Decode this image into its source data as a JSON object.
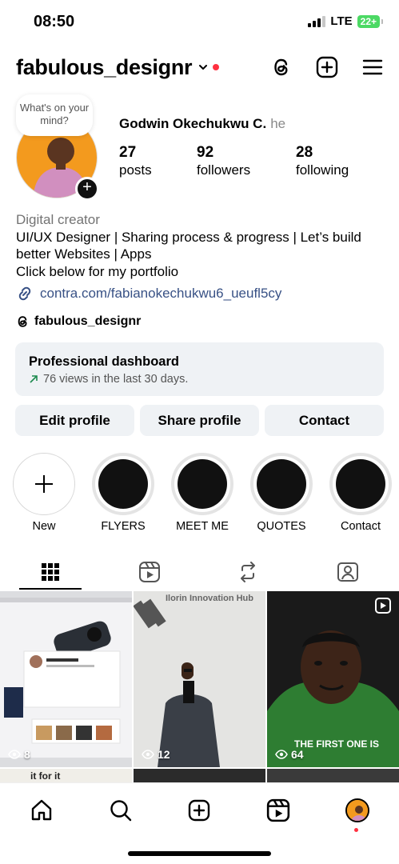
{
  "status": {
    "time": "08:50",
    "network": "LTE",
    "battery": "22+"
  },
  "header": {
    "username": "fabulous_designr"
  },
  "note_bubble": "What's on your mind?",
  "profile": {
    "full_name": "Godwin Okechukwu C.",
    "pronoun": "he",
    "stats": [
      {
        "num": "27",
        "label": "posts"
      },
      {
        "num": "92",
        "label": "followers"
      },
      {
        "num": "28",
        "label": "following"
      }
    ],
    "category": "Digital creator",
    "bio_line1": "UI/UX Designer | Sharing process & progress | Let’s build better Websites | Apps",
    "bio_line2": "Click below for my portfolio",
    "link": "contra.com/fabianokechukwu6_ueufl5cy",
    "threads_handle": "fabulous_designr"
  },
  "dashboard": {
    "title": "Professional dashboard",
    "subtitle": "76 views in the last 30 days."
  },
  "buttons": {
    "edit": "Edit profile",
    "share": "Share profile",
    "contact": "Contact"
  },
  "highlights": [
    "New",
    "FLYERS",
    "MEET ME",
    "QUOTES",
    "Contact"
  ],
  "grid": {
    "counts": [
      "8",
      "12",
      "64"
    ],
    "post2_text": "Ilorin Innovation Hub",
    "post3_caption": "THE FIRST ONE IS",
    "row2_text": "it for it"
  },
  "colors": {
    "link": "#385185",
    "notification": "#ff3040",
    "button_bg": "#eff2f5",
    "battery": "#4cd964"
  }
}
